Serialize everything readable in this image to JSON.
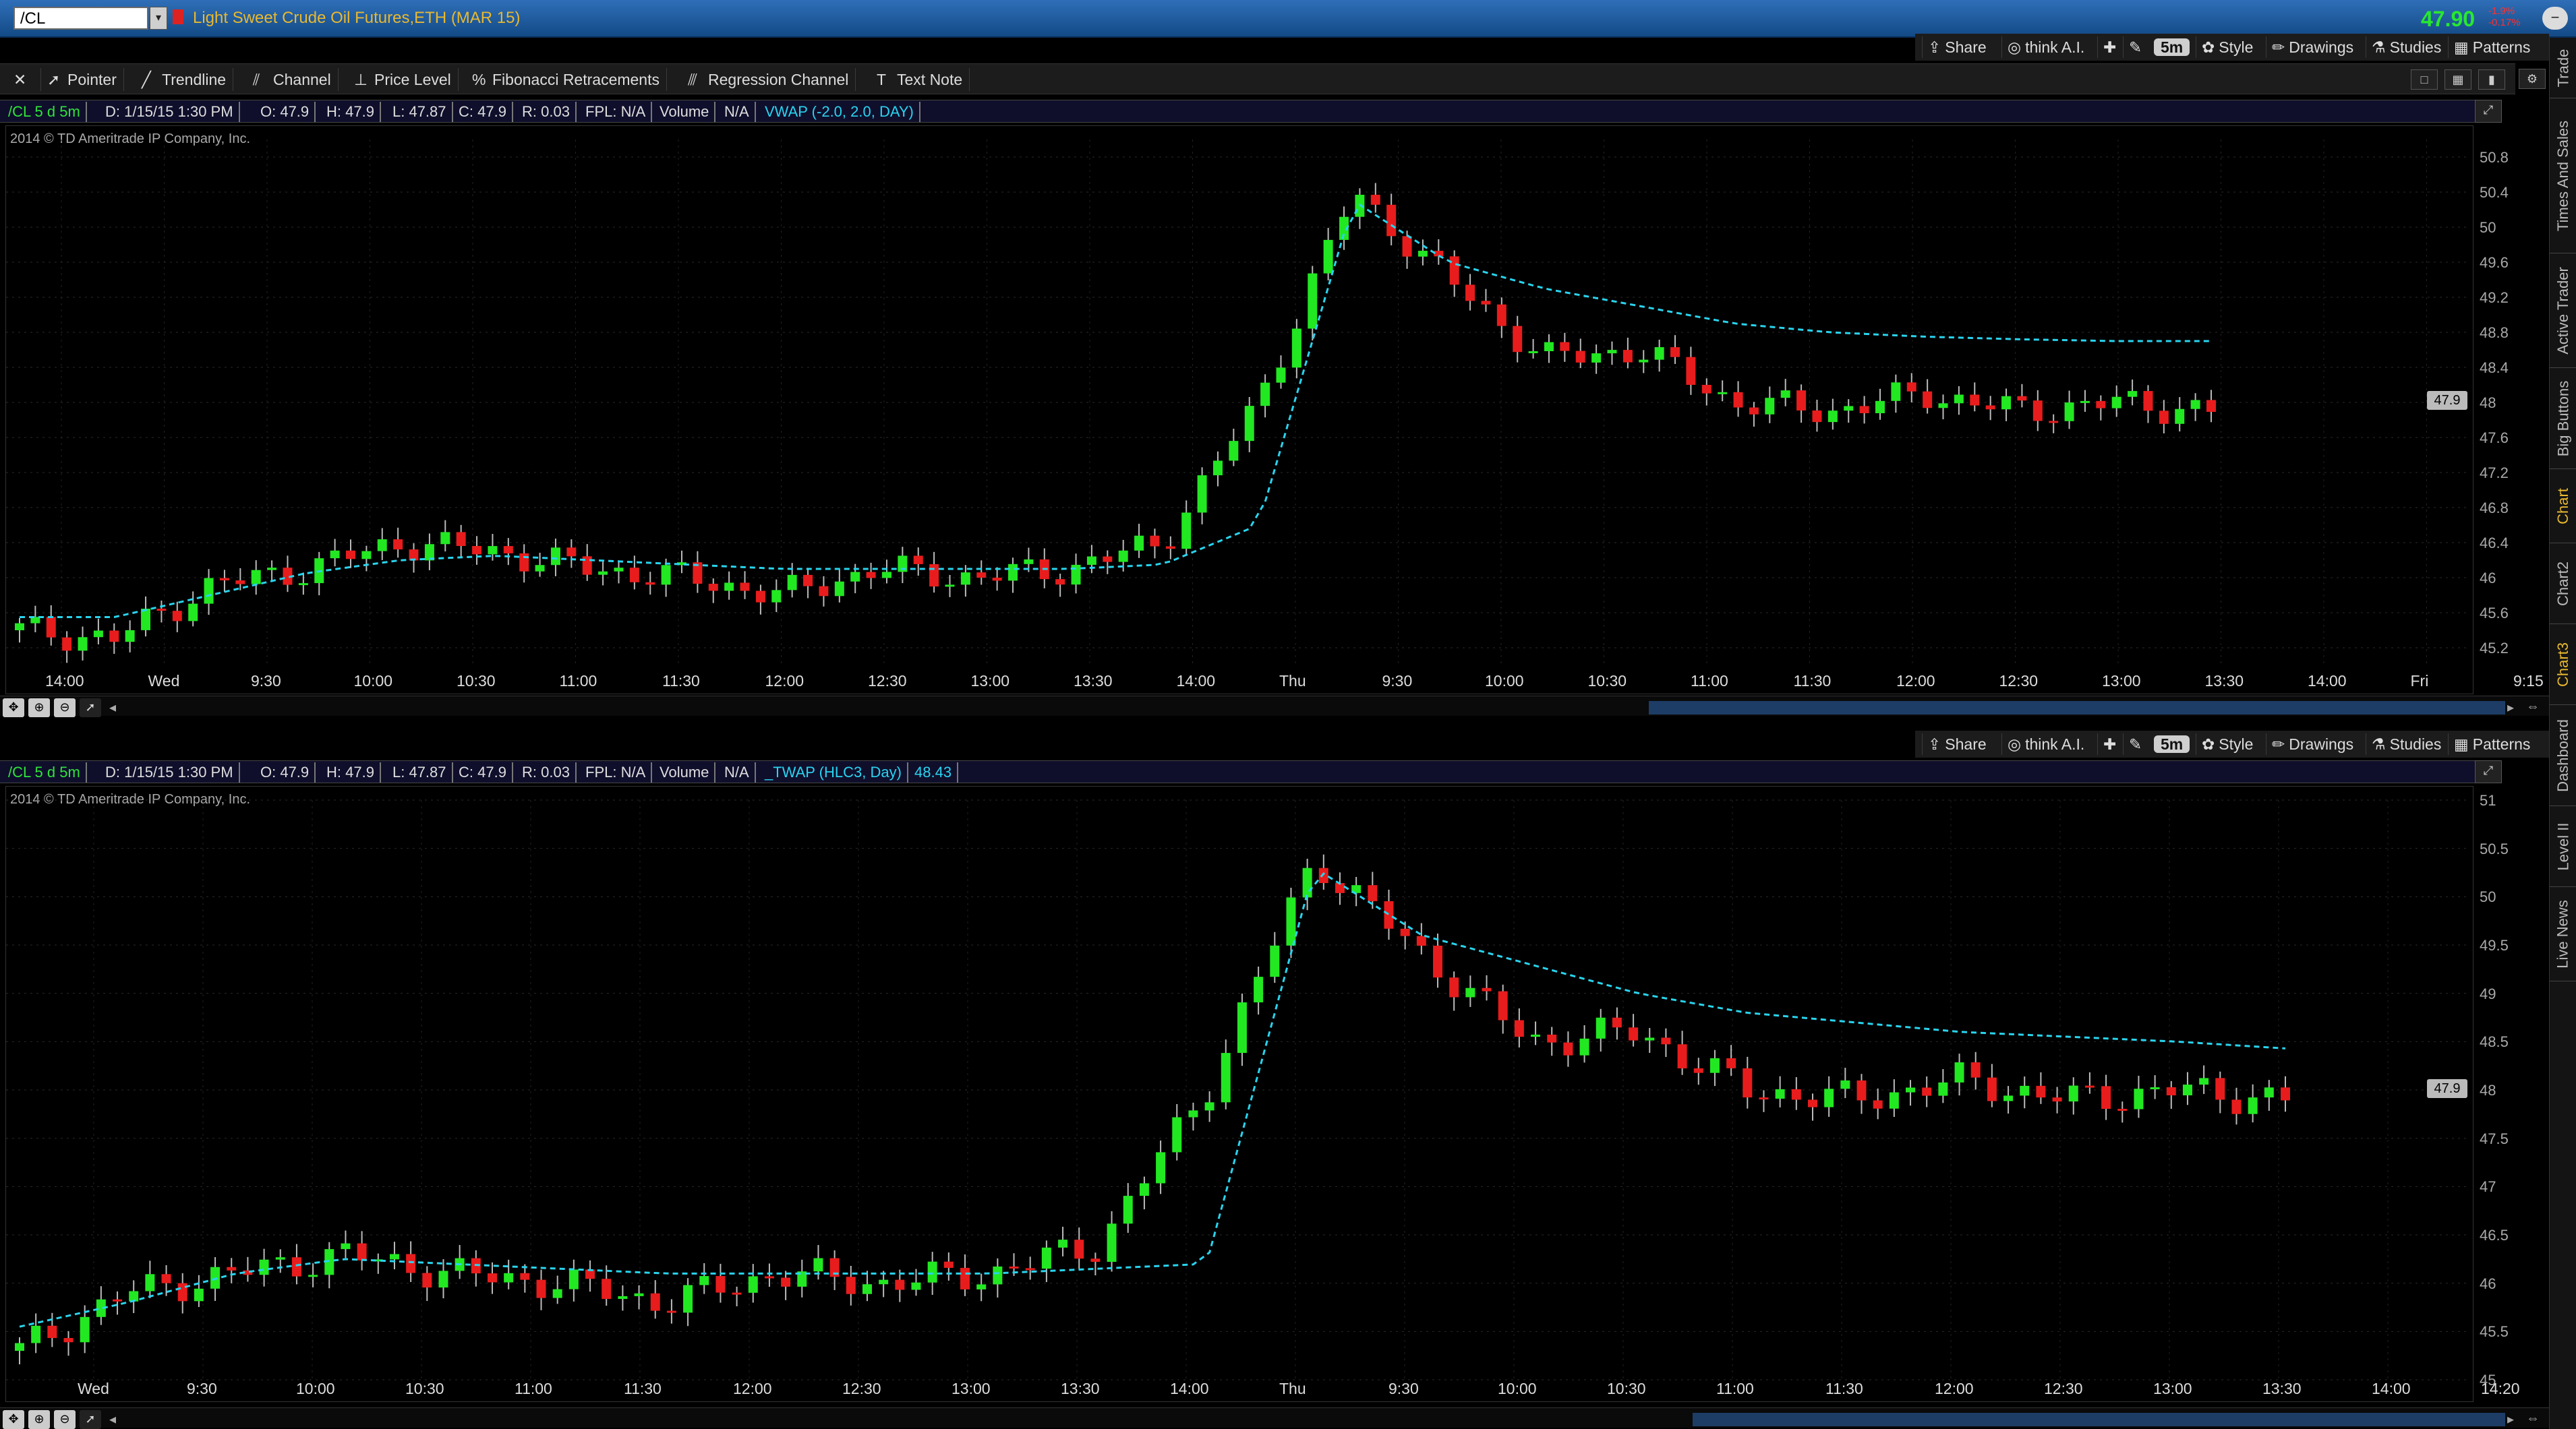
{
  "header": {
    "symbol": "/CL",
    "instrument": "Light Sweet Crude Oil Futures,ETH (MAR 15)",
    "last_price": "47.90",
    "change_line1": "-1.9%",
    "change_line2": "-0.17%"
  },
  "drawing_toolbar": {
    "tools": [
      "Pointer",
      "Trendline",
      "Channel",
      "Price Level",
      "Fibonacci Retracements",
      "Regression Channel",
      "Text Note"
    ]
  },
  "chart_actions": {
    "share": "Share",
    "think_ai": "think A.I.",
    "aggregation": "5m",
    "style": "Style",
    "drawings": "Drawings",
    "studies": "Studies",
    "patterns": "Patterns"
  },
  "side_tabs": [
    "Trade",
    "Times And Sales",
    "Active Trader",
    "Big Buttons",
    "Chart",
    "Chart2",
    "Chart3",
    "Dashboard",
    "Level II",
    "Live News"
  ],
  "colors": {
    "up_candle": "#22e822",
    "down_candle": "#e81c1c",
    "study_line": "#29d4ee",
    "axis_text": "#aaaaaa"
  },
  "panes": [
    {
      "info": {
        "symbol_period": "/CL 5 d 5m",
        "date": "D: 1/15/15 1:30 PM",
        "open": "O: 47.9",
        "high": "H: 47.9",
        "low": "L: 47.87",
        "close": "C: 47.9",
        "range": "R: 0.03",
        "fpl": "FPL: N/A",
        "volume_label": "Volume",
        "volume_value": "N/A",
        "study": "VWAP (-2.0, 2.0, DAY)",
        "study_value": ""
      },
      "copyright": "2014 © TD Ameritrade IP Company, Inc.",
      "price_tag": "47.9",
      "yticks": [
        "50.8",
        "50.4",
        "50",
        "49.6",
        "49.2",
        "48.8",
        "48.4",
        "48",
        "47.6",
        "47.2",
        "46.8",
        "46.4",
        "46",
        "45.6",
        "45.2"
      ],
      "xticks": [
        "14:00",
        "Wed",
        "9:30",
        "10:00",
        "10:30",
        "11:00",
        "11:30",
        "12:00",
        "12:30",
        "13:00",
        "13:30",
        "14:00",
        "Thu",
        "9:30",
        "10:00",
        "10:30",
        "11:00",
        "11:30",
        "12:00",
        "12:30",
        "13:00",
        "13:30",
        "14:00",
        "Fri",
        "9:15"
      ]
    },
    {
      "info": {
        "symbol_period": "/CL 5 d 5m",
        "date": "D: 1/15/15 1:30 PM",
        "open": "O: 47.9",
        "high": "H: 47.9",
        "low": "L: 47.87",
        "close": "C: 47.9",
        "range": "R: 0.03",
        "fpl": "FPL: N/A",
        "volume_label": "Volume",
        "volume_value": "N/A",
        "study": "_TWAP (HLC3, Day)",
        "study_value": "48.43"
      },
      "copyright": "2014 © TD Ameritrade IP Company, Inc.",
      "price_tag": "47.9",
      "yticks": [
        "51",
        "50.5",
        "50",
        "49.5",
        "49",
        "48.5",
        "48",
        "47.5",
        "47",
        "46.5",
        "46",
        "45.5",
        "45"
      ],
      "xticks": [
        "Wed",
        "9:30",
        "10:00",
        "10:30",
        "11:00",
        "11:30",
        "12:00",
        "12:30",
        "13:00",
        "13:30",
        "14:00",
        "Thu",
        "9:30",
        "10:00",
        "10:30",
        "11:00",
        "11:30",
        "12:00",
        "12:30",
        "13:00",
        "13:30",
        "14:00",
        "14:20"
      ]
    }
  ],
  "chart_data": [
    {
      "type": "candlestick",
      "title": "/CL 5 d 5m",
      "study": "VWAP (-2.0, 2.0, DAY)",
      "ylim": [
        45.0,
        51.0
      ],
      "x": [
        "13:55",
        "14:00",
        "Wed 9:00",
        "9:30",
        "10:00",
        "10:30",
        "11:00",
        "11:30",
        "12:00",
        "12:30",
        "13:00",
        "13:30",
        "14:00",
        "14:10",
        "Thu 9:00",
        "9:30",
        "10:00",
        "10:30",
        "11:00",
        "11:30",
        "12:00",
        "12:30",
        "13:00",
        "13:30"
      ],
      "close": [
        45.4,
        45.3,
        45.9,
        46.1,
        46.4,
        46.3,
        46.1,
        46.0,
        45.8,
        46.1,
        46.0,
        46.1,
        46.4,
        48.0,
        50.4,
        49.4,
        48.5,
        48.6,
        48.0,
        47.9,
        48.1,
        47.9,
        48.0,
        47.9
      ],
      "vwap": [
        45.55,
        45.55,
        45.8,
        46.05,
        46.2,
        46.25,
        46.2,
        46.15,
        46.1,
        46.1,
        46.1,
        46.1,
        46.15,
        46.6,
        50.3,
        49.6,
        49.3,
        49.1,
        48.9,
        48.8,
        48.75,
        48.72,
        48.7,
        48.7
      ]
    },
    {
      "type": "candlestick",
      "title": "/CL 5 d 5m",
      "study": "_TWAP (HLC3, Day)",
      "ylim": [
        45.0,
        51.0
      ],
      "x": [
        "Wed 9:00",
        "9:30",
        "10:00",
        "10:30",
        "11:00",
        "11:30",
        "12:00",
        "12:30",
        "13:00",
        "13:30",
        "14:00",
        "14:10",
        "Thu 9:00",
        "9:30",
        "10:00",
        "10:30",
        "11:00",
        "11:30",
        "12:00",
        "12:30",
        "13:00",
        "13:30"
      ],
      "close": [
        45.3,
        45.9,
        46.1,
        46.3,
        46.1,
        46.0,
        45.8,
        46.1,
        46.0,
        46.1,
        46.4,
        48.0,
        50.4,
        49.4,
        48.5,
        48.6,
        48.0,
        47.9,
        48.1,
        47.9,
        48.0,
        47.9
      ],
      "twap": [
        45.55,
        45.8,
        46.1,
        46.25,
        46.2,
        46.15,
        46.1,
        46.1,
        46.1,
        46.1,
        46.15,
        46.2,
        50.3,
        49.6,
        49.3,
        49.0,
        48.8,
        48.7,
        48.6,
        48.55,
        48.5,
        48.43
      ]
    }
  ]
}
